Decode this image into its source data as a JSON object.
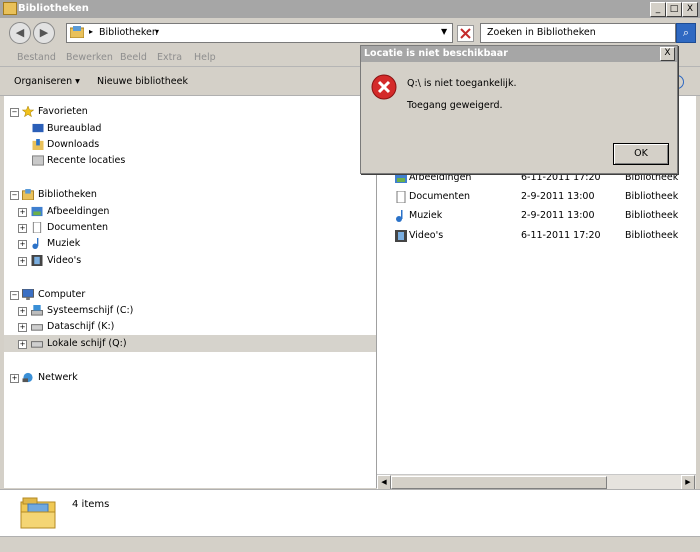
{
  "window": {
    "title": "Bibliotheken",
    "controls": {
      "minimize": "_",
      "maximize": "□",
      "close": "X"
    }
  },
  "address": {
    "crumb": "Bibliotheken",
    "search_placeholder": "Zoeken in Bibliotheken"
  },
  "menu": [
    "Bestand",
    "Bewerken",
    "Beeld",
    "Extra",
    "Help"
  ],
  "commands": {
    "organize": "Organiseren ▾",
    "new_library": "Nieuwe bibliotheek"
  },
  "nav": {
    "favorites": {
      "label": "Favorieten",
      "items": [
        "Bureaublad",
        "Downloads",
        "Recente locaties"
      ]
    },
    "libraries": {
      "label": "Bibliotheken",
      "items": [
        "Afbeeldingen",
        "Documenten",
        "Muziek",
        "Video's"
      ]
    },
    "computer": {
      "label": "Computer",
      "items": [
        "Systeemschijf (C:)",
        "Dataschijf (K:)",
        "Lokale schijf (Q:)"
      ]
    },
    "network": {
      "label": "Netwerk"
    }
  },
  "files": [
    {
      "name": "Afbeeldingen",
      "date": "6-11-2011 17:20",
      "type": "Bibliotheek",
      "icon": "pictures-library-icon"
    },
    {
      "name": "Documenten",
      "date": "2-9-2011 13:00",
      "type": "Bibliotheek",
      "icon": "documents-library-icon"
    },
    {
      "name": "Muziek",
      "date": "2-9-2011 13:00",
      "type": "Bibliotheek",
      "icon": "music-library-icon"
    },
    {
      "name": "Video's",
      "date": "6-11-2011 17:20",
      "type": "Bibliotheek",
      "icon": "videos-library-icon"
    }
  ],
  "details": {
    "count": "4 items"
  },
  "dialog": {
    "title": "Locatie is niet beschikbaar",
    "message_line1": "Q:\\ is niet toegankelijk.",
    "message_line2": "Toegang geweigerd.",
    "ok_label": "OK",
    "close": "X"
  }
}
